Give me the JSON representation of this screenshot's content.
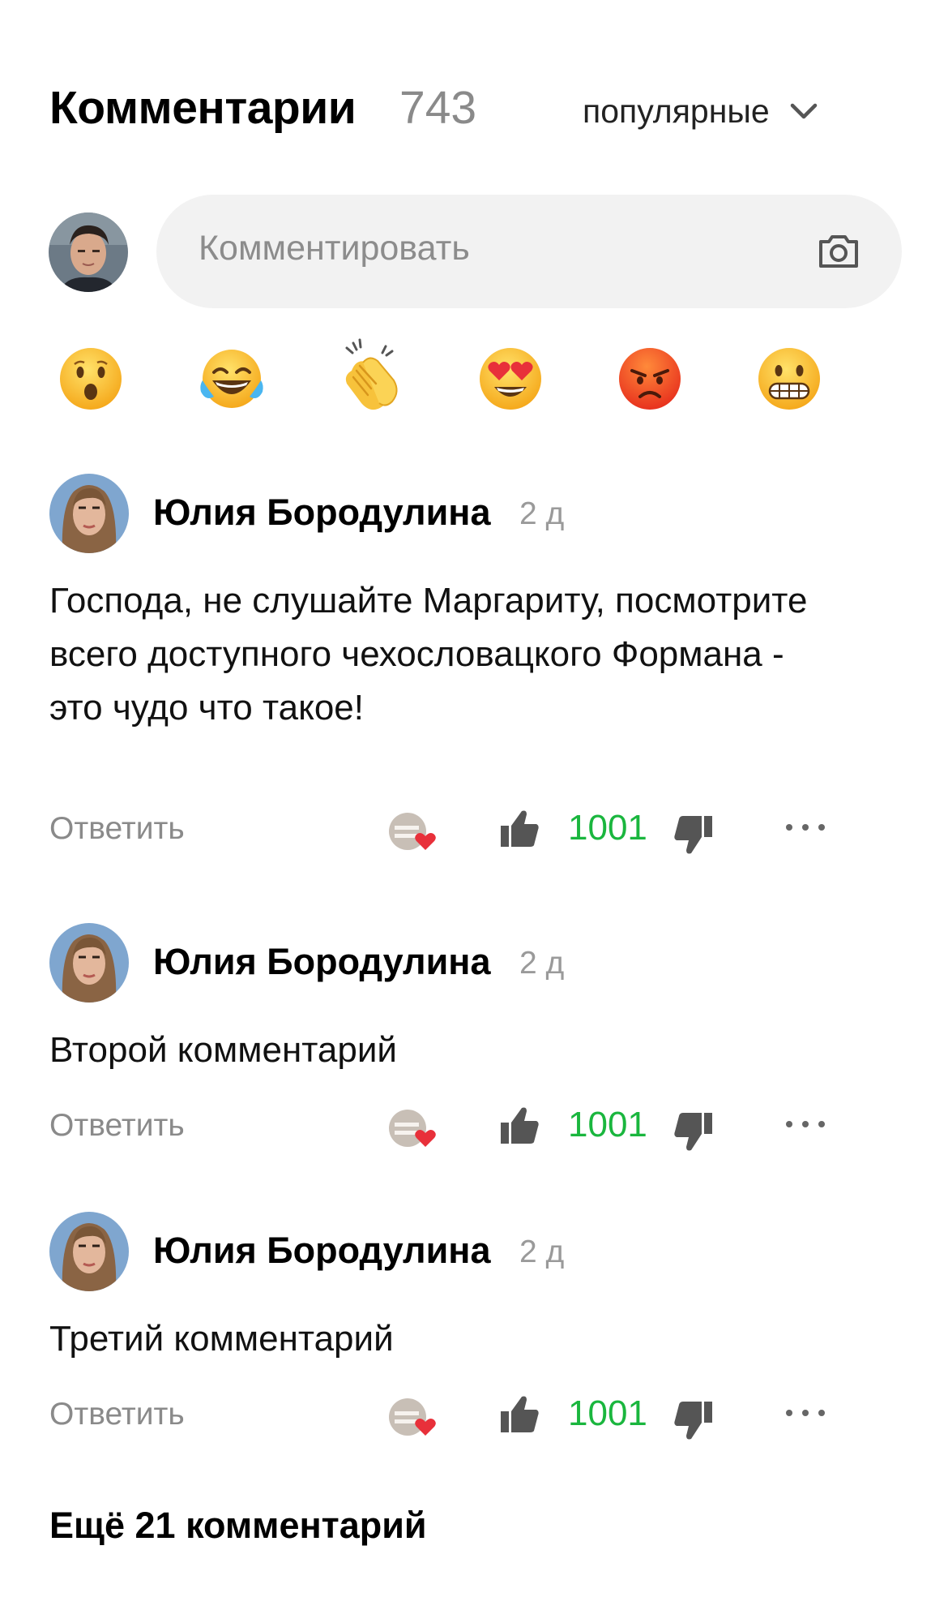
{
  "header": {
    "title": "Комментарии",
    "count": "743",
    "sort_label": "популярные",
    "sort_icon": "chevron-down-icon"
  },
  "composer": {
    "placeholder": "Комментировать",
    "camera_icon": "camera-icon"
  },
  "emoji_reactions": [
    {
      "name": "surprised-face-emoji"
    },
    {
      "name": "tears-of-joy-emoji"
    },
    {
      "name": "clapping-hands-emoji"
    },
    {
      "name": "heart-eyes-emoji"
    },
    {
      "name": "angry-face-emoji"
    },
    {
      "name": "grimacing-face-emoji"
    }
  ],
  "comments": [
    {
      "author": "Юлия Бородулина",
      "time": "2 д",
      "text": "Господа, не слушайте Маргариту, посмотрите всего доступного чехословацкого Формана - это чудо что такое!",
      "reply_label": "Ответить",
      "score": "1001"
    },
    {
      "author": "Юлия Бородулина",
      "time": "2 д",
      "text": "Второй комментарий",
      "reply_label": "Ответить",
      "score": "1001"
    },
    {
      "author": "Юлия Бородулина",
      "time": "2 д",
      "text": "Третий комментарий",
      "reply_label": "Ответить",
      "score": "1001"
    }
  ],
  "more_comments_label": "Ещё 21 комментарий",
  "colors": {
    "score_green": "#1ab63e",
    "muted_gray": "#8a8a8a",
    "input_bg": "#f2f2f2"
  }
}
